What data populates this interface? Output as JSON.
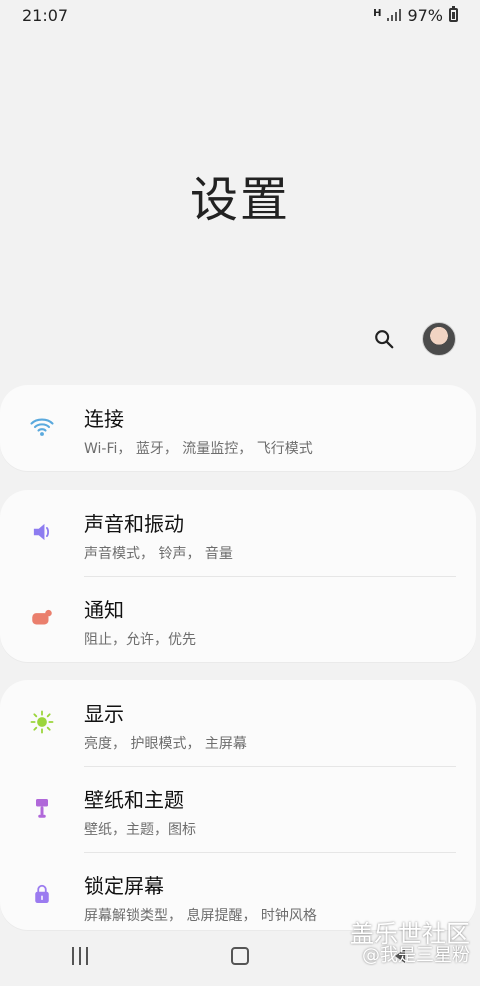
{
  "status_bar": {
    "time": "21:07",
    "network_label": "H",
    "battery_percent": "97%"
  },
  "page": {
    "title": "设置"
  },
  "actions": {
    "search_icon": "search-icon",
    "avatar_label": "profile"
  },
  "cards": [
    {
      "rows": [
        {
          "title": "连接",
          "subtitle": "Wi-Fi， 蓝牙， 流量监控， 飞行模式",
          "icon": "wifi-icon"
        }
      ]
    },
    {
      "rows": [
        {
          "title": "声音和振动",
          "subtitle": "声音模式， 铃声， 音量",
          "icon": "volume-icon"
        },
        {
          "title": "通知",
          "subtitle": "阻止，允许，优先",
          "icon": "notification-icon"
        }
      ]
    },
    {
      "rows": [
        {
          "title": "显示",
          "subtitle": "亮度， 护眼模式， 主屏幕",
          "icon": "brightness-icon"
        },
        {
          "title": "壁纸和主题",
          "subtitle": "壁纸，主题，图标",
          "icon": "paint-icon"
        },
        {
          "title": "锁定屏幕",
          "subtitle": "屏幕解锁类型， 息屏提醒， 时钟风格",
          "icon": "lock-icon"
        }
      ]
    }
  ],
  "watermark": {
    "line1": "盖乐世社区",
    "line2": "@我是三星粉"
  },
  "colors": {
    "wifi": "#5aa9dd",
    "volume": "#8d7cf0",
    "notification": "#ea7f6d",
    "display": "#9bd53b",
    "theme": "#b068d9",
    "lock": "#9b7bf0"
  }
}
